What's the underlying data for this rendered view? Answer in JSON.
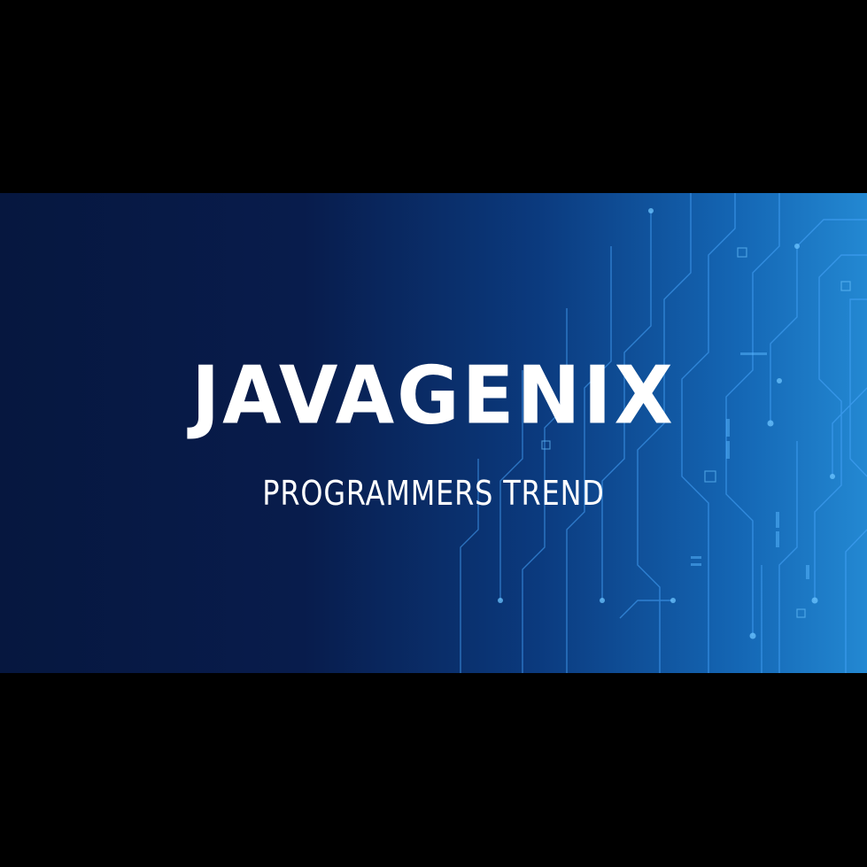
{
  "banner": {
    "title": "JAVAGENIX",
    "subtitle": "PROGRAMMERS TREND"
  },
  "colors": {
    "background": "#000000",
    "banner_dark": "#06173f",
    "banner_light": "#2388d2",
    "circuit_lines": "#4aa8ff",
    "text": "#ffffff"
  },
  "decoration": {
    "pattern": "circuit-board"
  }
}
